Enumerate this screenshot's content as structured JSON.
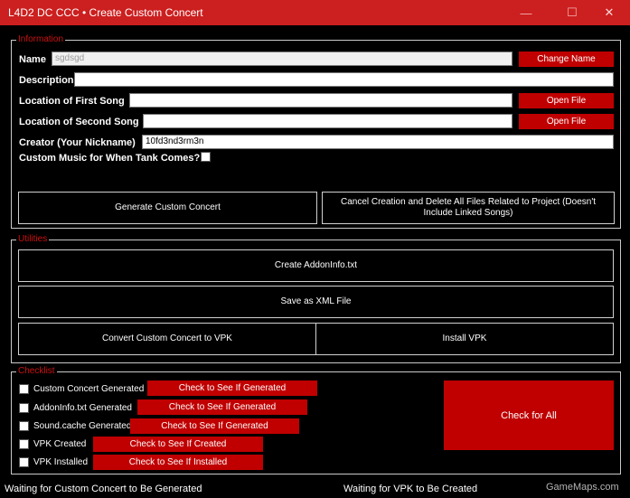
{
  "window": {
    "title": "L4D2 DC CCC • Create Custom Concert",
    "minimize_glyph": "—",
    "maximize_glyph": "☐",
    "close_glyph": "✕"
  },
  "information": {
    "group_label": "Information",
    "name_label": "Name",
    "name_value": "sgdsgd",
    "change_name_button": "Change Name",
    "description_label": "Description",
    "description_value": "",
    "first_song_label": "Location of First Song",
    "first_song_value": "",
    "open_file_1": "Open File",
    "second_song_label": "Location of Second Song",
    "second_song_value": "",
    "open_file_2": "Open File",
    "creator_label": "Creator (Your Nickname)",
    "creator_value": "10fd3nd3rm3n",
    "tank_music_label": "Custom Music for When Tank Comes?",
    "tank_music_checked": false,
    "generate_button": "Generate Custom Concert",
    "cancel_button": "Cancel Creation and Delete All Files Related to Project (Doesn't Include Linked Songs)"
  },
  "utilities": {
    "group_label": "Utilities",
    "create_addoninfo": "Create AddonInfo.txt",
    "save_xml": "Save as XML File",
    "convert_vpk": "Convert Custom Concert to VPK",
    "install_vpk": "Install VPK"
  },
  "checklist": {
    "group_label": "Checklist",
    "items": [
      {
        "label": "Custom Concert Generated",
        "button": "Check to See If Generated",
        "checked": false
      },
      {
        "label": "AddonInfo.txt Generated",
        "button": "Check to See If Generated",
        "checked": false
      },
      {
        "label": "Sound.cache Generated",
        "button": "Check to See If Generated",
        "checked": false
      },
      {
        "label": "VPK Created",
        "button": "Check to See If Created",
        "checked": false
      },
      {
        "label": "VPK Installed",
        "button": "Check to See If Installed",
        "checked": false
      }
    ],
    "check_all_button": "Check for All"
  },
  "status": {
    "left": "Waiting for Custom Concert to Be Generated",
    "right": "Waiting for VPK to Be Created"
  },
  "watermark": "GameMaps.com",
  "colors": {
    "accent": "#cc1f1f",
    "button_red": "#c00000",
    "group_label_red": "#cc1111",
    "background": "#000000"
  }
}
